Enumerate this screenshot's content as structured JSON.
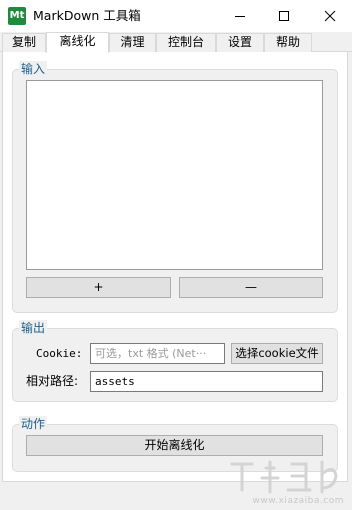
{
  "window": {
    "app_icon": "Mt",
    "title": "MarkDown 工具箱",
    "controls": [
      "minimize-icon",
      "maximize-icon",
      "close-icon"
    ]
  },
  "tabs": [
    {
      "label": "复制",
      "active": false
    },
    {
      "label": "离线化",
      "active": true
    },
    {
      "label": "清理",
      "active": false
    },
    {
      "label": "控制台",
      "active": false
    },
    {
      "label": "设置",
      "active": false
    },
    {
      "label": "帮助",
      "active": false
    }
  ],
  "input_group": {
    "legend": "输入",
    "textarea_value": "",
    "add_label": "+",
    "remove_label": "—"
  },
  "output_group": {
    "legend": "输出",
    "cookie_label": "Cookie:",
    "cookie_value": "",
    "cookie_placeholder": "可选，txt 格式 (Net···",
    "choose_cookie_label": "选择cookie文件",
    "path_label": "相对路径:",
    "path_value": "assets"
  },
  "action_group": {
    "legend": "动作",
    "start_label": "开始离线化"
  },
  "watermark": {
    "text": "www.xiazaiba.com"
  },
  "colors": {
    "legend_text": "#1d5f8e",
    "app_icon_bg": "#1e8a3c",
    "window_bg": "#f0f0f0",
    "button_bg": "#e1e1e1"
  }
}
